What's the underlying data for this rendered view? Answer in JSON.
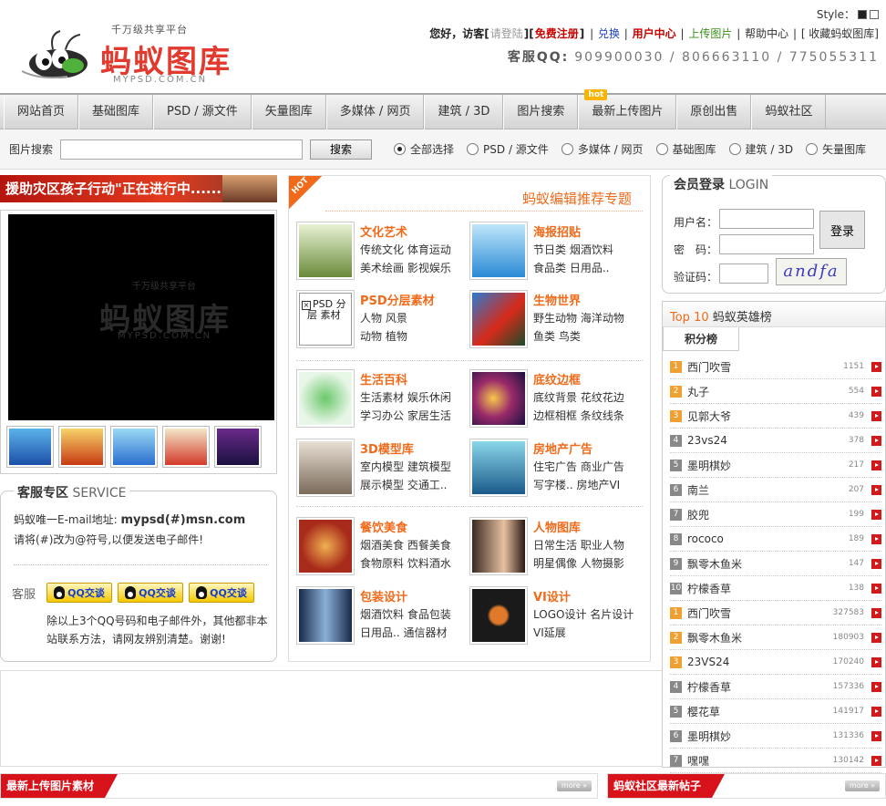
{
  "header": {
    "logo_slogan": "千万级共享平台",
    "logo_brand": "蚂蚁图库",
    "logo_domain": "MYPSD.COM.CN",
    "style_label": "Style：",
    "greeting": "您好，访客[",
    "login_link": "请登陆",
    "bracket_sep": "][",
    "register_link": "免费注册",
    "bracket_close": "]",
    "exchange_link": "兑换",
    "user_center_link": "用户中心",
    "upload_link": "上传图片",
    "help_link": "帮助中心",
    "favorite_link": "[ 收藏蚂蚁图库]",
    "pipe": "|",
    "service_label": "客服QQ:",
    "service_numbers": "909900030 / 806663110 / 775055311"
  },
  "nav": {
    "items": [
      "网站首页",
      "基础图库",
      "PSD / 源文件",
      "矢量图库",
      "多媒体 / 网页",
      "建筑 / 3D",
      "图片搜索",
      "最新上传图片",
      "原创出售",
      "蚂蚁社区"
    ],
    "hot_badge": "hot"
  },
  "search": {
    "label": "图片搜索",
    "input_value": "",
    "button": "搜索",
    "options": [
      "全部选择",
      "PSD / 源文件",
      "多媒体 / 网页",
      "基础图库",
      "建筑 / 3D",
      "矢量图库"
    ],
    "selected_index": 0
  },
  "left": {
    "banner": "援助灾区孩子行动\"正在进行中.........",
    "player_watermark_slogan": "千万级共享平台",
    "player_watermark_brand": "蚂蚁图库",
    "player_watermark_domain": "MYPSD.COM.CN",
    "service": {
      "title_bold": "客服专区",
      "title_en": "SERVICE",
      "email_line_prefix": "蚂蚁唯一E-mail地址: ",
      "email": "mypsd(#)msn.com",
      "email_note": "请将(#)改为@符号,以便发送电子邮件!",
      "kefu_label": "客服",
      "qq_button": "QQ交谈",
      "note": "除以上3个QQ号码和电子邮件外，其他都非本站联系方法，请网友辨别清楚。谢谢!"
    }
  },
  "middle": {
    "hot_badge": "HOT",
    "title": "蚂蚁编辑推荐专题",
    "categories": [
      {
        "name": "文化艺术",
        "line1": "传统文化 体育运动",
        "line2": "美术绘画 影视娱乐"
      },
      {
        "name": "海报招贴",
        "line1": "节日类 烟酒饮料",
        "line2": "食品类 日用品.."
      },
      {
        "name": "PSD分层素材",
        "line1": "人物 风景",
        "line2": "动物 植物",
        "placeholder": "PSD 分层 素材"
      },
      {
        "name": "生物世界",
        "line1": "野生动物 海洋动物",
        "line2": "鱼类 鸟类"
      },
      {
        "name": "生活百科",
        "line1": "生活素材 娱乐休闲",
        "line2": "学习办公 家居生活"
      },
      {
        "name": "底纹边框",
        "line1": "底纹背景 花纹花边",
        "line2": "边框相框 条纹线条"
      },
      {
        "name": "3D模型库",
        "line1": "室内模型 建筑模型",
        "line2": "展示模型 交通工.."
      },
      {
        "name": "房地产广告",
        "line1": "住宅广告 商业广告",
        "line2": "写字楼.. 房地产VI"
      },
      {
        "name": "餐饮美食",
        "line1": "烟酒美食 西餐美食",
        "line2": "食物原料 饮料酒水"
      },
      {
        "name": "人物图库",
        "line1": "日常生活 职业人物",
        "line2": "明星偶像 人物摄影"
      },
      {
        "name": "包装设计",
        "line1": "烟酒饮料 食品包装",
        "line2": "日用品.. 通信器材"
      },
      {
        "name": "VI设计",
        "line1": "LOGO设计 名片设计",
        "line2": "VI延展"
      }
    ]
  },
  "right": {
    "login": {
      "title_bold": "会员登录",
      "title_en": "LOGIN",
      "username_label": "用户名：",
      "password_label": "密　码：",
      "captcha_label": "验证码：",
      "button": "登录",
      "captcha_text": "andfa"
    },
    "top10": {
      "title_highlight": "Top 10",
      "title_rest": " 蚂蚁英雄榜",
      "tab": "积分榜",
      "rows": [
        {
          "rank": "1",
          "name": "西门吹雪",
          "score": "1151"
        },
        {
          "rank": "2",
          "name": "丸子",
          "score": "554"
        },
        {
          "rank": "3",
          "name": "见郭大爷",
          "score": "439"
        },
        {
          "rank": "4",
          "name": "23vs24",
          "score": "378"
        },
        {
          "rank": "5",
          "name": "墨明棋妙",
          "score": "217"
        },
        {
          "rank": "6",
          "name": "南兰",
          "score": "207"
        },
        {
          "rank": "7",
          "name": "胶兜",
          "score": "199"
        },
        {
          "rank": "8",
          "name": "rococo",
          "score": "189"
        },
        {
          "rank": "9",
          "name": "飘零木鱼米",
          "score": "147"
        },
        {
          "rank": "10",
          "name": "柠檬香草",
          "score": "138"
        },
        {
          "rank": "1",
          "name": "西门吹雪",
          "score": "327583"
        },
        {
          "rank": "2",
          "name": "飘零木鱼米",
          "score": "180903"
        },
        {
          "rank": "3",
          "name": "23VS24",
          "score": "170240"
        },
        {
          "rank": "4",
          "name": "柠檬香草",
          "score": "157336"
        },
        {
          "rank": "5",
          "name": "樱花草",
          "score": "141917"
        },
        {
          "rank": "6",
          "name": "墨明棋妙",
          "score": "131336"
        },
        {
          "rank": "7",
          "name": "嘿嘿",
          "score": "130142"
        }
      ]
    }
  },
  "bottom": {
    "latest_title": "最新上传图片素材",
    "community_title": "蚂蚁社区最新帖子",
    "more": "more »"
  },
  "colors": {
    "accent_orange": "#f06a1a",
    "brand_red": "#d8121a"
  }
}
